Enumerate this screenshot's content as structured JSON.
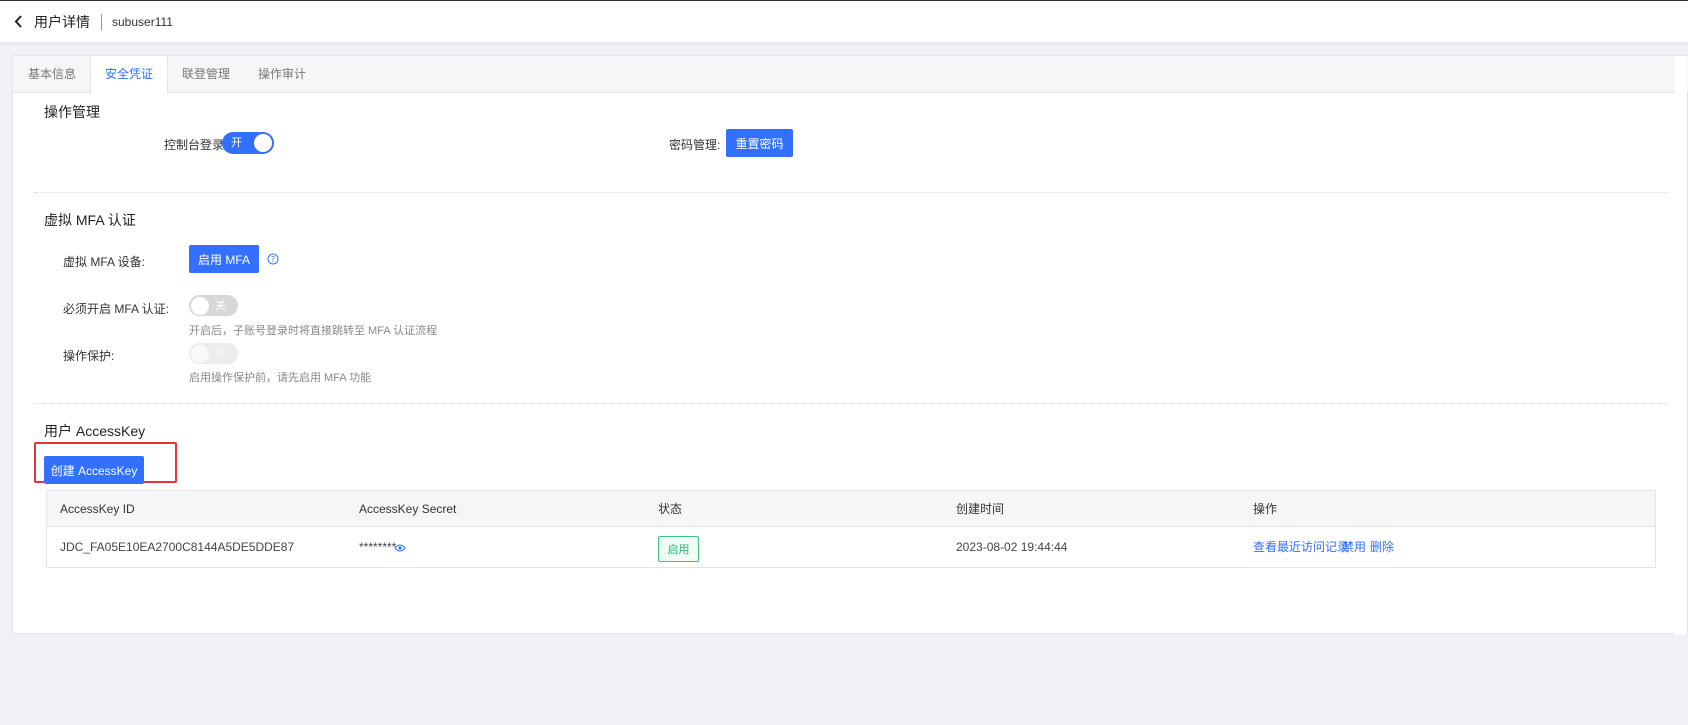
{
  "header": {
    "title": "用户详情",
    "username": "subuser111"
  },
  "tabs": [
    {
      "label": "基本信息",
      "active": false
    },
    {
      "label": "安全凭证",
      "active": true
    },
    {
      "label": "联登管理",
      "active": false
    },
    {
      "label": "操作审计",
      "active": false
    }
  ],
  "operation_section": {
    "title": "操作管理",
    "console_login_label": "控制台登录:",
    "console_login_switch": "开",
    "console_login_on": true,
    "password_label": "密码管理:",
    "reset_password_button": "重置密码"
  },
  "mfa_section": {
    "title": "虚拟 MFA 认证",
    "device_label": "虚拟 MFA 设备:",
    "enable_mfa_button": "启用 MFA",
    "force_mfa_label": "必须开启 MFA 认证:",
    "force_mfa_switch": "关",
    "force_mfa_on": false,
    "force_mfa_hint": "开启后，子账号登录时将直接跳转至 MFA 认证流程",
    "op_protect_label": "操作保护:",
    "op_protect_switch": "关",
    "op_protect_on": false,
    "op_protect_hint": "启用操作保护前，请先启用 MFA 功能"
  },
  "accesskey_section": {
    "title": "用户 AccessKey",
    "create_button": "创建 AccessKey",
    "columns": [
      "AccessKey ID",
      "AccessKey Secret",
      "状态",
      "创建时间",
      "操作"
    ],
    "rows": [
      {
        "id": "JDC_FA05E10EA2700C8144A5DE5DDE87",
        "secret": "********",
        "status": "启用",
        "created": "2023-08-02 19:44:44",
        "actions": [
          "查看最近访问记录",
          "禁用",
          "删除"
        ]
      }
    ]
  },
  "colors": {
    "primary": "#3370ff",
    "success": "#2cb873",
    "highlight": "#e8323a"
  }
}
